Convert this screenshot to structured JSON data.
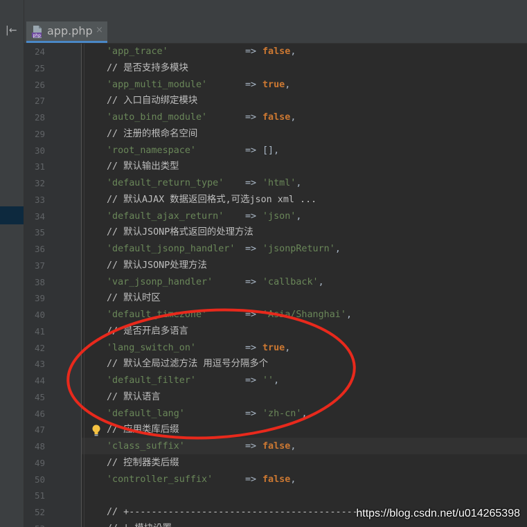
{
  "colors": {
    "string": "#6a8759",
    "keyword": "#cc7832",
    "comment": "#bfbfbf",
    "line_number": "#606366",
    "annotation": "#e8291c",
    "tab_underline": "#4a88c7"
  },
  "toolbar": {
    "collapse_icon": "|←"
  },
  "tabs": [
    {
      "label": "app.php",
      "icon": "php-file-icon",
      "close": "×"
    }
  ],
  "editor": {
    "lines": [
      {
        "n": "24",
        "key": "'app_trace'",
        "arrow": "=>",
        "value": "false",
        "value_type": "keyword",
        "end": ","
      },
      {
        "n": "25",
        "comment": "// 是否支持多模块"
      },
      {
        "n": "26",
        "key": "'app_multi_module'",
        "arrow": "=>",
        "value": "true",
        "value_type": "keyword",
        "end": ","
      },
      {
        "n": "27",
        "comment": "// 入口自动绑定模块"
      },
      {
        "n": "28",
        "key": "'auto_bind_module'",
        "arrow": "=>",
        "value": "false",
        "value_type": "keyword",
        "end": ","
      },
      {
        "n": "29",
        "comment": "// 注册的根命名空间"
      },
      {
        "n": "30",
        "key": "'root_namespace'",
        "arrow": "=>",
        "value": "[]",
        "value_type": "plain",
        "end": ","
      },
      {
        "n": "31",
        "comment": "// 默认输出类型"
      },
      {
        "n": "32",
        "key": "'default_return_type'",
        "arrow": "=>",
        "value": "'html'",
        "value_type": "string",
        "end": ","
      },
      {
        "n": "33",
        "comment": "// 默认AJAX 数据返回格式,可选json xml ..."
      },
      {
        "n": "34",
        "key": "'default_ajax_return'",
        "arrow": "=>",
        "value": "'json'",
        "value_type": "string",
        "end": ","
      },
      {
        "n": "35",
        "comment": "// 默认JSONP格式返回的处理方法"
      },
      {
        "n": "36",
        "key": "'default_jsonp_handler'",
        "arrow": "=>",
        "value": "'jsonpReturn'",
        "value_type": "string",
        "end": ","
      },
      {
        "n": "37",
        "comment": "// 默认JSONP处理方法"
      },
      {
        "n": "38",
        "key": "'var_jsonp_handler'",
        "arrow": "=>",
        "value": "'callback'",
        "value_type": "string",
        "end": ","
      },
      {
        "n": "39",
        "comment": "// 默认时区"
      },
      {
        "n": "40",
        "key": "'default_timezone'",
        "arrow": "=>",
        "value": "'Asia/Shanghai'",
        "value_type": "string",
        "end": ","
      },
      {
        "n": "41",
        "comment": "// 是否开启多语言"
      },
      {
        "n": "42",
        "key": "'lang_switch_on'",
        "arrow": "=>",
        "value": "true",
        "value_type": "keyword",
        "end": ","
      },
      {
        "n": "43",
        "comment": "// 默认全局过滤方法 用逗号分隔多个"
      },
      {
        "n": "44",
        "key": "'default_filter'",
        "arrow": "=>",
        "value": "''",
        "value_type": "string",
        "end": ","
      },
      {
        "n": "45",
        "comment": "// 默认语言"
      },
      {
        "n": "46",
        "key": "'default_lang'",
        "arrow": "=>",
        "value": "'zh-cn'",
        "value_type": "string",
        "end": ","
      },
      {
        "n": "47",
        "comment": "// 应用类库后缀",
        "bulb": true
      },
      {
        "n": "48",
        "key": "'class_suffix'",
        "arrow": "=>",
        "value": "false",
        "value_type": "keyword",
        "end": ","
      },
      {
        "n": "49",
        "comment": "// 控制器类后缀"
      },
      {
        "n": "50",
        "key": "'controller_suffix'",
        "arrow": "=>",
        "value": "false",
        "value_type": "keyword",
        "end": ","
      },
      {
        "n": "51"
      },
      {
        "n": "52",
        "comment": "// +------------------------------------------------"
      },
      {
        "n": "53",
        "comment": "// | 模块设置"
      }
    ]
  },
  "watermark": "https://blog.csdn.net/u014265398"
}
